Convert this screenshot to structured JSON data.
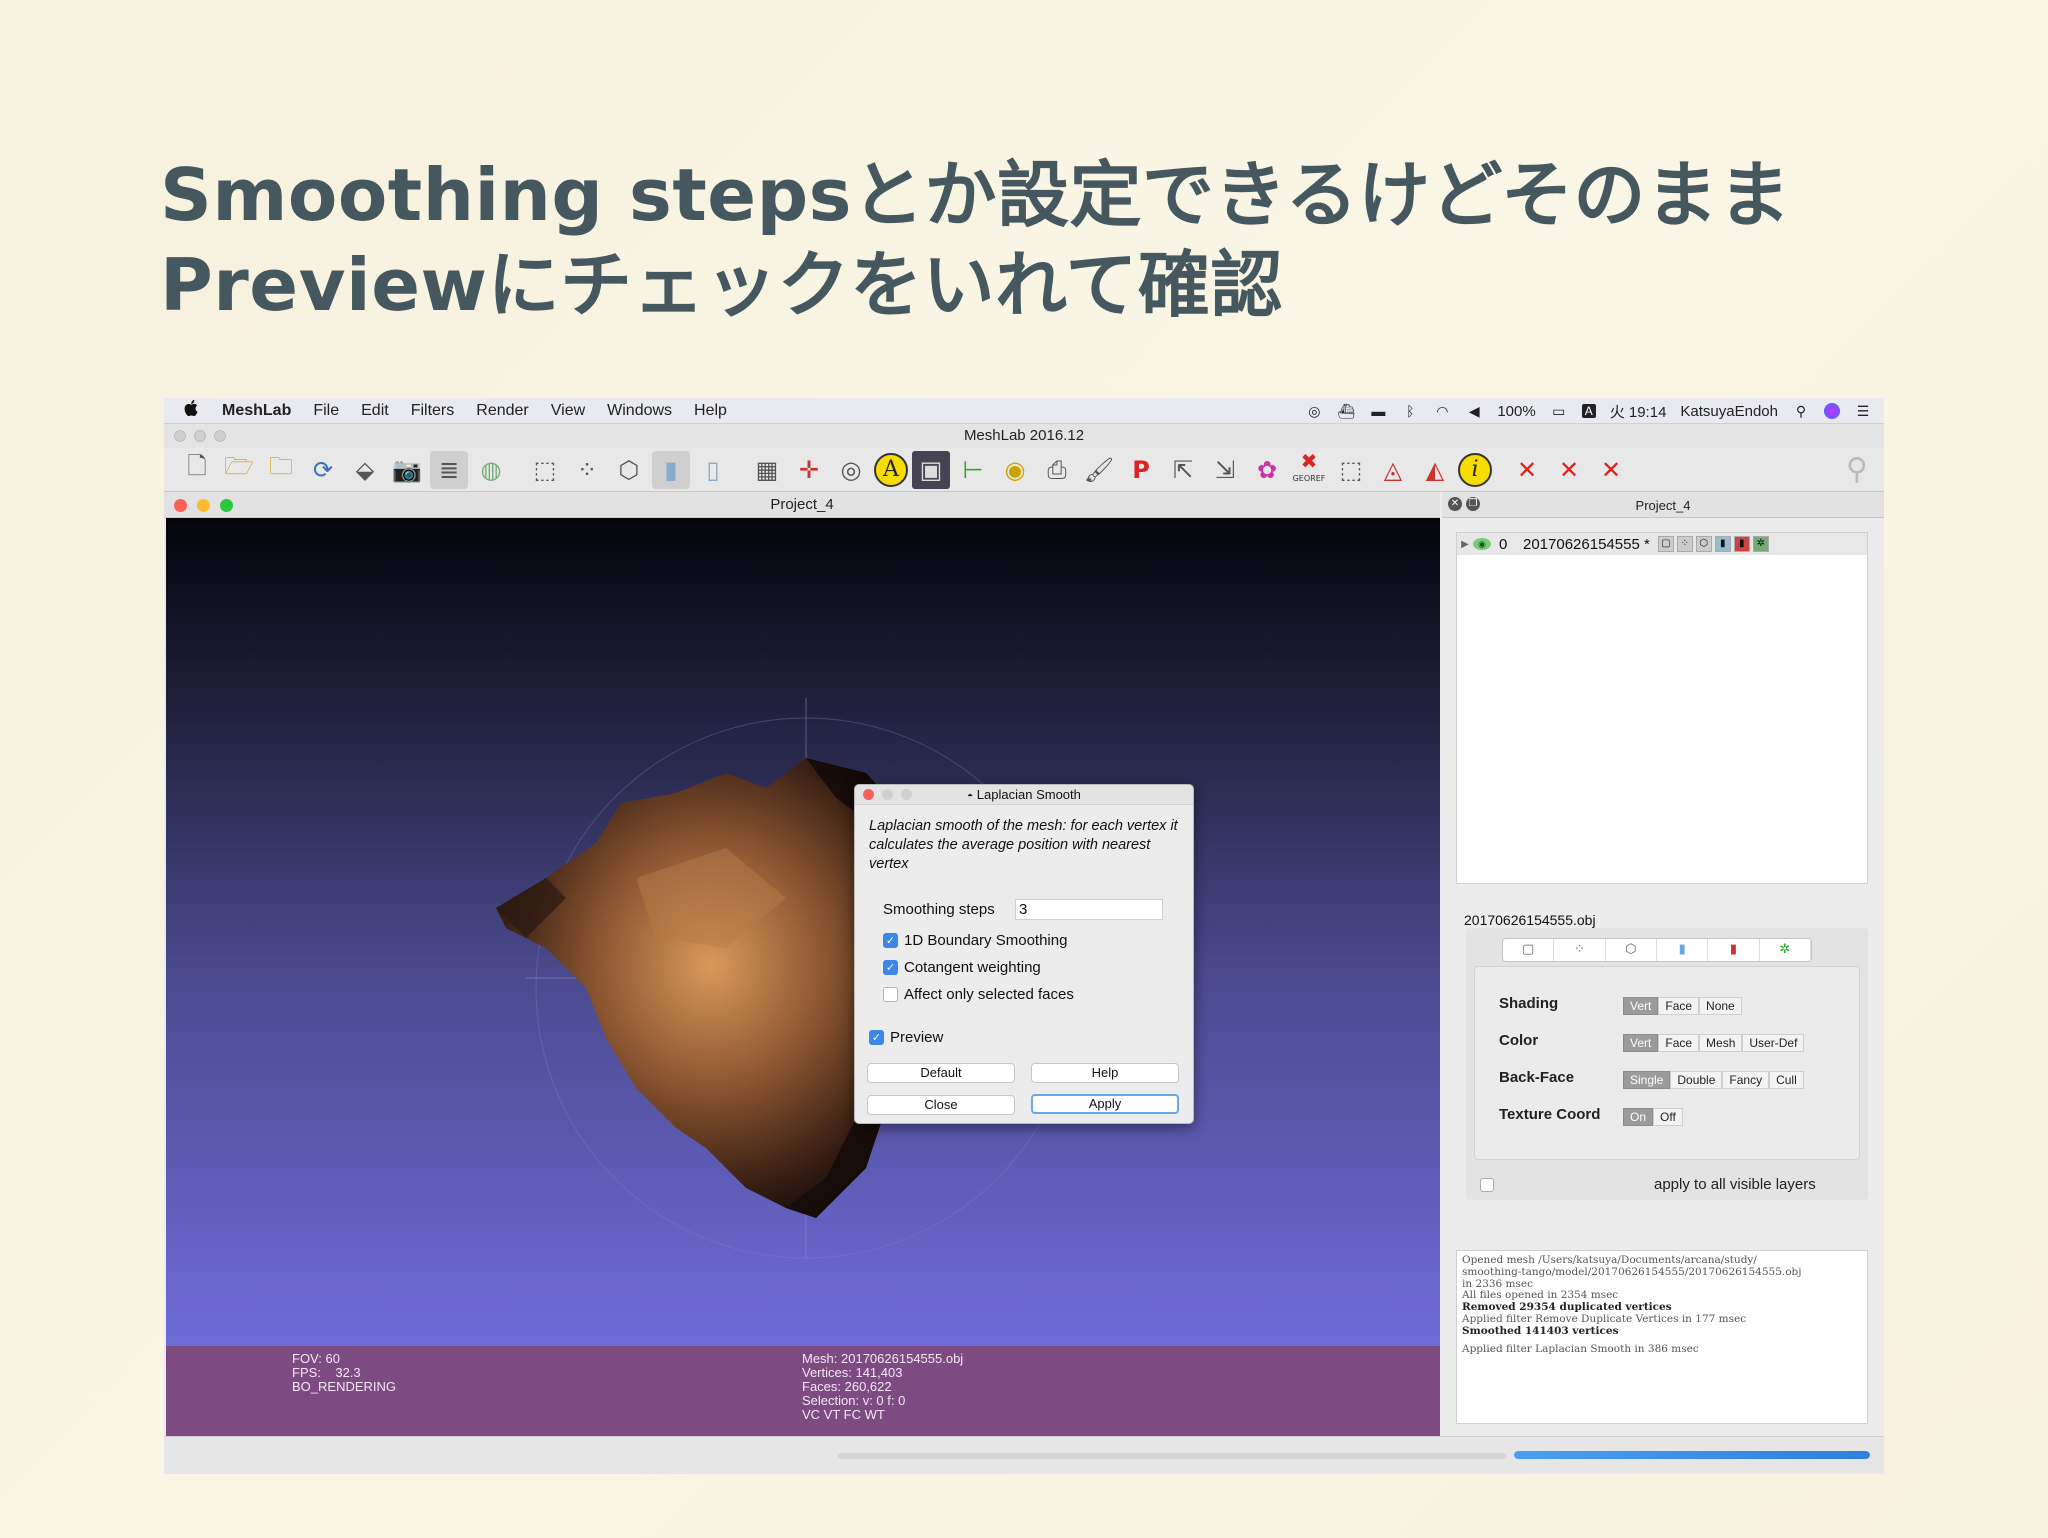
{
  "slide": {
    "title_line1": "Smoothing stepsとか設定できるけどそのまま",
    "title_line2": "Previewにチェックをいれて確認"
  },
  "menubar": {
    "apple": "",
    "app_name": "MeshLab",
    "items": [
      "File",
      "Edit",
      "Filters",
      "Render",
      "View",
      "Windows",
      "Help"
    ],
    "battery": "100%",
    "input_method": "A",
    "clock": "火 19:14",
    "user": "KatsuyaEndoh"
  },
  "app": {
    "window_title": "MeshLab 2016.12",
    "toolbar_labels": {
      "georef": "GEOREF"
    }
  },
  "viewer": {
    "title": "Project_4",
    "info_left": [
      "FOV: 60",
      "FPS:    32.3",
      "BO_RENDERING"
    ],
    "info_mid": [
      "Mesh: 20170626154555.obj",
      "Vertices: 141,403",
      "Faces: 260,622",
      "Selection: v: 0 f: 0",
      "VC VT FC WT"
    ]
  },
  "progress": {
    "fraction": 1.0
  },
  "dock": {
    "title": "Project_4",
    "layer": {
      "index": "0",
      "name": "20170626154555 *"
    },
    "object_name": "20170626154555.obj",
    "render_rows": [
      {
        "label": "Shading",
        "options": [
          "Vert",
          "Face",
          "None"
        ],
        "selected": 0
      },
      {
        "label": "Color",
        "options": [
          "Vert",
          "Face",
          "Mesh",
          "User-Def"
        ],
        "selected": 0
      },
      {
        "label": "Back-Face",
        "options": [
          "Single",
          "Double",
          "Fancy",
          "Cull"
        ],
        "selected": 0
      },
      {
        "label": "Texture Coord",
        "options": [
          "On",
          "Off"
        ],
        "selected": 0
      }
    ],
    "apply_all_label": "apply to all visible layers",
    "log": [
      {
        "text": "Opened mesh /Users/katsuya/Documents/arcana/study/",
        "bold": false
      },
      {
        "text": "smoothing-tango/model/20170626154555/20170626154555.obj",
        "bold": false
      },
      {
        "text": "in 2336 msec",
        "bold": false
      },
      {
        "text": "All files opened in 2354 msec",
        "bold": false
      },
      {
        "text": "Removed 29354 duplicated vertices",
        "bold": true
      },
      {
        "text": "Applied filter Remove Duplicate Vertices in 177 msec",
        "bold": false
      },
      {
        "text": "Smoothed 141403 vertices",
        "bold": true
      },
      {
        "text": "Applied filter Laplacian Smooth in 386 msec",
        "bold": false,
        "gap": true
      }
    ]
  },
  "dialog": {
    "title": "Laplacian Smooth",
    "description": "Laplacian smooth of the mesh: for each vertex it calculates the average position with nearest vertex",
    "steps_label": "Smoothing steps",
    "steps_value": "3",
    "options": [
      {
        "label": "1D Boundary Smoothing",
        "checked": true
      },
      {
        "label": "Cotangent weighting",
        "checked": true
      },
      {
        "label": "Affect only selected faces",
        "checked": false
      }
    ],
    "preview_label": "Preview",
    "preview_checked": true,
    "buttons": {
      "default": "Default",
      "help": "Help",
      "close": "Close",
      "apply": "Apply"
    }
  }
}
